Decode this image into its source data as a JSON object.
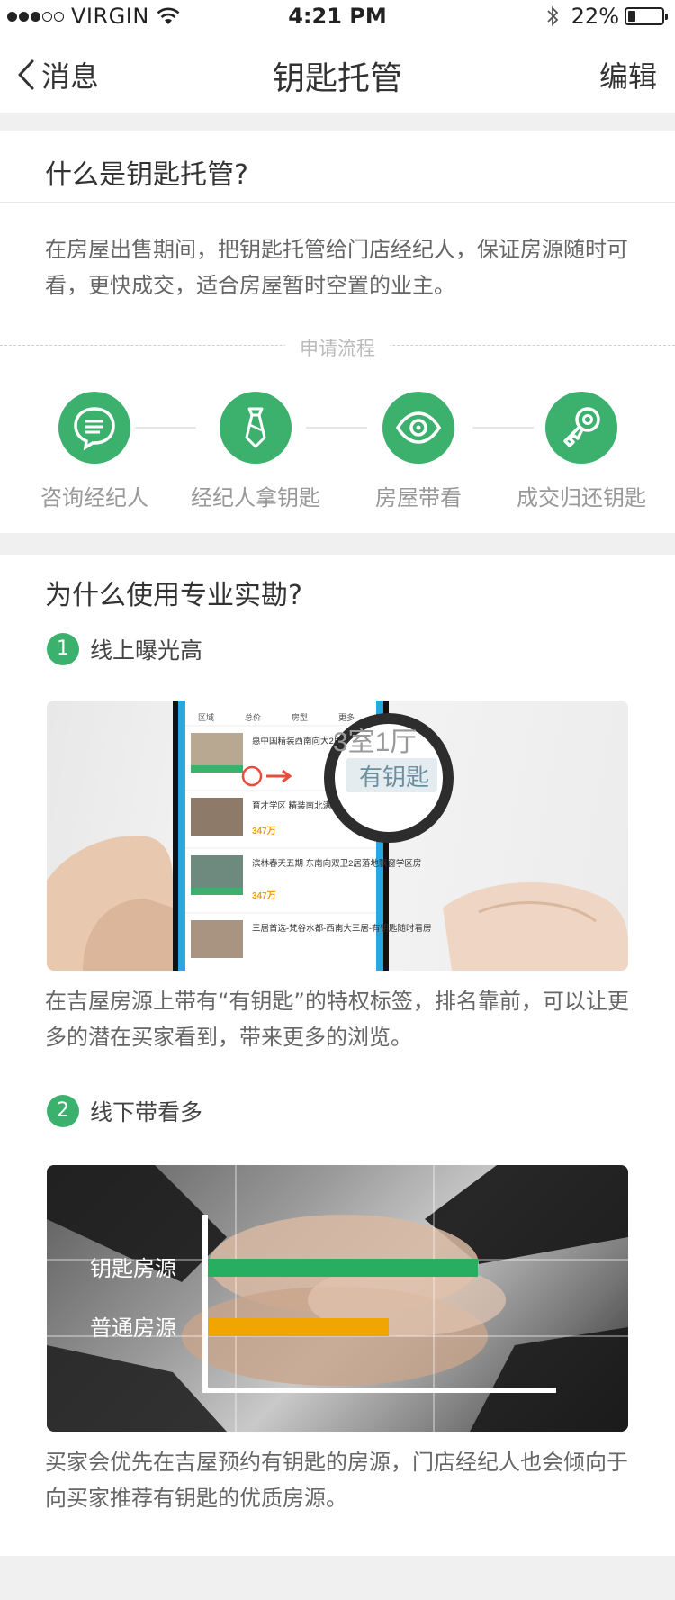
{
  "status_bar": {
    "carrier": "VIRGIN",
    "time": "4:21 PM",
    "battery_text": "22%",
    "battery_level": 0.22,
    "signal_bars_filled": 3,
    "signal_bars_total": 5
  },
  "nav": {
    "back_label": "消息",
    "title": "钥匙托管",
    "edit_label": "编辑"
  },
  "intro": {
    "heading": "什么是钥匙托管?",
    "description": "在房屋出售期间，把钥匙托管给门店经纪人，保证房源随时可看，更快成交，适合房屋暂时空置的业主。",
    "flow_label": "申请流程",
    "steps": [
      {
        "label": "咨询经纪人",
        "icon": "chat-bubble-icon"
      },
      {
        "label": "经纪人拿钥匙",
        "icon": "tie-icon"
      },
      {
        "label": "房屋带看",
        "icon": "eye-icon"
      },
      {
        "label": "成交归还钥匙",
        "icon": "key-icon"
      }
    ]
  },
  "why": {
    "heading": "为什么使用专业实勘?",
    "points": [
      {
        "number": "1",
        "title": "线上曝光高",
        "description": "在吉屋房源上带有“有钥匙”的特权标签，排名靠前，可以让更多的潜在买家看到，带来更多的浏览。"
      },
      {
        "number": "2",
        "title": "线下带看多",
        "description": "买家会优先在吉屋预约有钥匙的房源，门店经纪人也会倾向于向买家推荐有钥匙的优质房源。"
      }
    ],
    "photo1": {
      "filters": [
        "区域",
        "总价",
        "房型",
        "更多"
      ],
      "magnifier_top": "3室1厅",
      "magnifier_tag": "有钥匙",
      "listings": [
        {
          "title": "惠中国精装西南向大2居 有车位",
          "price": ""
        },
        {
          "title": "育才学区 精装南北满五唯一",
          "price": "347万"
        },
        {
          "title": "滨林春天五期 东南向双卫2居落地飘窗学区房",
          "price": "347万"
        },
        {
          "title": "三居首选-梵谷水都-西南大三居-有钥匙随时看房",
          "price": ""
        }
      ]
    },
    "photo2_chart": {
      "bars": [
        {
          "label": "钥匙房源",
          "value": 1.0,
          "color": "#27ae60"
        },
        {
          "label": "普通房源",
          "value": 0.67,
          "color": "#f0a500"
        }
      ]
    }
  },
  "colors": {
    "accent": "#3cb06d"
  }
}
